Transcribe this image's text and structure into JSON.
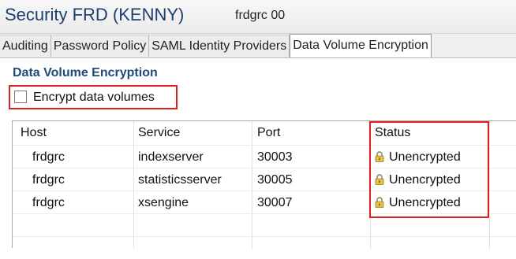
{
  "window": {
    "title": "Security FRD (KENNY)",
    "subtitle": "frdgrc 00"
  },
  "tabs": [
    {
      "label": "Auditing",
      "active": false
    },
    {
      "label": "Password Policy",
      "active": false
    },
    {
      "label": "SAML Identity Providers",
      "active": false
    },
    {
      "label": "Data Volume Encryption",
      "active": true
    }
  ],
  "section": {
    "title": "Data Volume Encryption"
  },
  "encrypt": {
    "label": "Encrypt data volumes",
    "checked": false
  },
  "table": {
    "columns": [
      "Host",
      "Service",
      "Port",
      "Status"
    ],
    "rows": [
      {
        "host": "frdgrc",
        "service": "indexserver",
        "port": "30003",
        "status": "Unencrypted",
        "icon": "lock-icon"
      },
      {
        "host": "frdgrc",
        "service": "statisticsserver",
        "port": "30005",
        "status": "Unencrypted",
        "icon": "lock-icon"
      },
      {
        "host": "frdgrc",
        "service": "xsengine",
        "port": "30007",
        "status": "Unencrypted",
        "icon": "lock-icon"
      }
    ]
  },
  "colors": {
    "title": "#1c3f6e",
    "section": "#1f4a7a",
    "highlight": "#e02020",
    "lock": "#d4a528"
  }
}
